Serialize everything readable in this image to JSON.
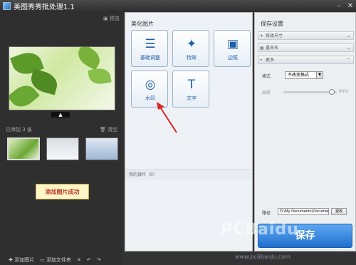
{
  "window": {
    "title": "美图秀秀批处理1.1"
  },
  "left": {
    "preview_label": "预览",
    "added_label": "已添加 3 张",
    "clear_label": "清空",
    "toast": "添加图片成功",
    "bottom": {
      "add_image": "添加图片",
      "add_folder": "添加文件夹"
    }
  },
  "middle": {
    "heading": "美化图片",
    "tools": [
      {
        "label": "基础调整",
        "icon": "sliders-icon"
      },
      {
        "label": "特效",
        "icon": "magic-wand-icon"
      },
      {
        "label": "边框",
        "icon": "frame-icon"
      },
      {
        "label": "水印",
        "icon": "watermark-icon"
      },
      {
        "label": "文字",
        "icon": "text-icon"
      }
    ],
    "ops_label": "我的操作（0）"
  },
  "right": {
    "heading": "保存设置",
    "sections": [
      "修改尺寸",
      "重命名",
      "更多"
    ],
    "format_label": "格式",
    "format_value": "不改变格式",
    "quality_label": "画质",
    "quality_value": "90%",
    "quality_fraction": 0.9,
    "path_label": "路径",
    "path_value": "D:\\My Documents\\Documents\\",
    "browse_label": "更改",
    "save_button": "保存"
  },
  "watermark": {
    "text": "PCBaidu",
    "sub": "www.pc6baidu.com"
  }
}
